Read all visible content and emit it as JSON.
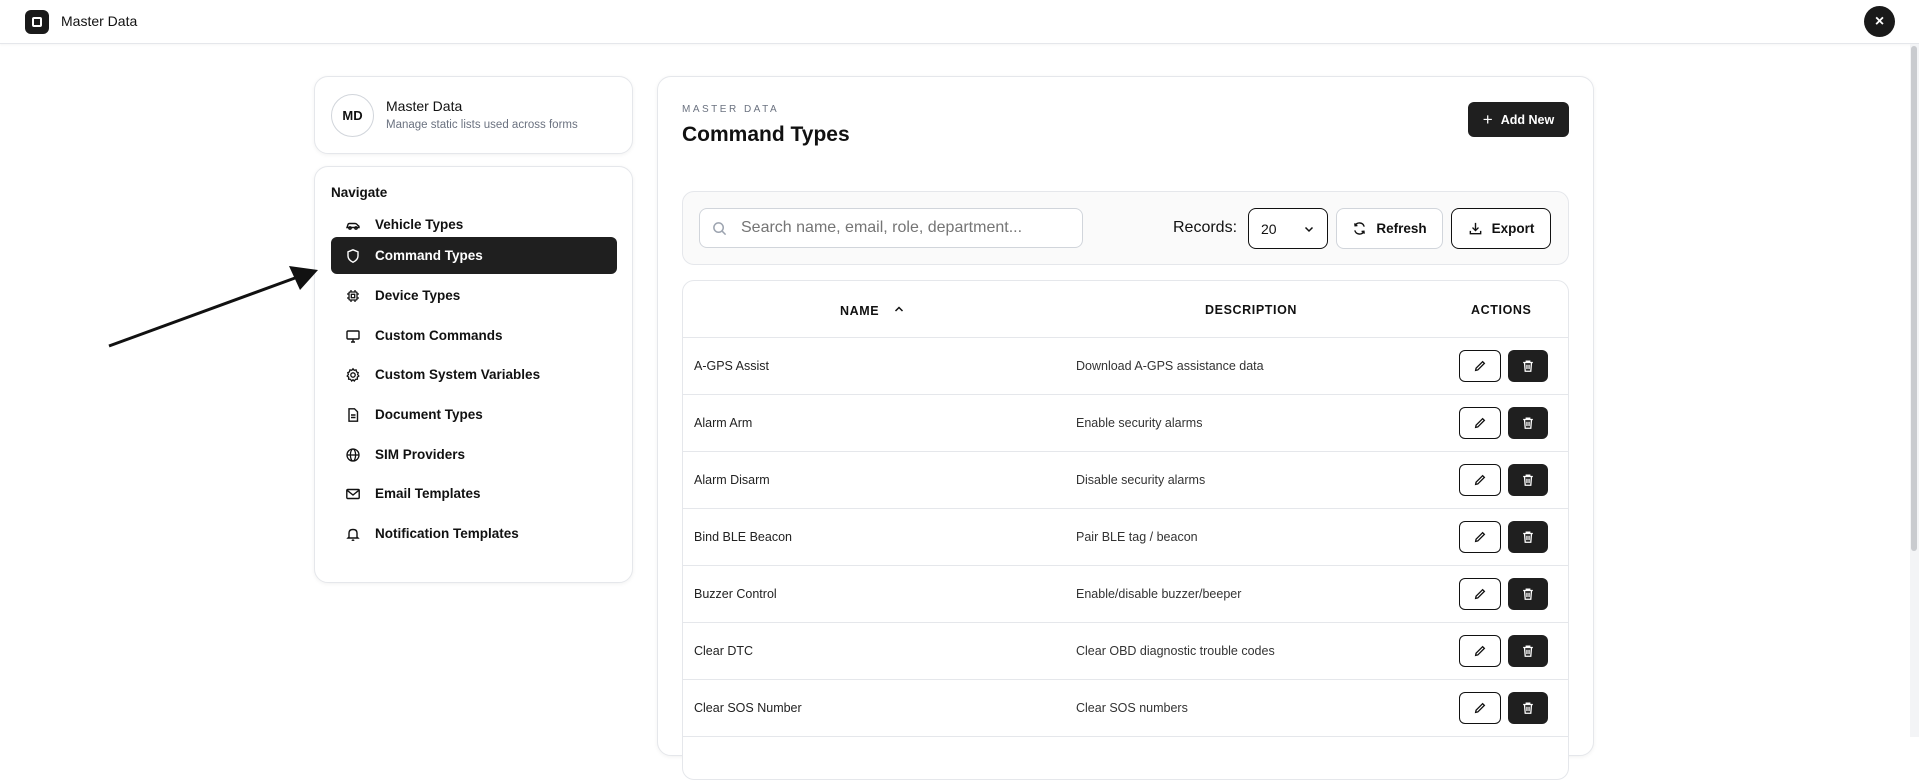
{
  "app": {
    "title": "Master Data",
    "close_label": "×"
  },
  "profile": {
    "initials": "MD",
    "title": "Master Data",
    "subtitle": "Manage static lists used across forms"
  },
  "nav": {
    "heading": "Navigate",
    "items": [
      {
        "label": "Vehicle Types",
        "icon": "car-icon",
        "active": false
      },
      {
        "label": "Command Types",
        "icon": "shield-icon",
        "active": true
      },
      {
        "label": "Device Types",
        "icon": "chip-icon",
        "active": false
      },
      {
        "label": "Custom Commands",
        "icon": "monitor-icon",
        "active": false
      },
      {
        "label": "Custom System Variables",
        "icon": "gear-icon",
        "active": false
      },
      {
        "label": "Document Types",
        "icon": "document-icon",
        "active": false
      },
      {
        "label": "SIM Providers",
        "icon": "globe-icon",
        "active": false
      },
      {
        "label": "Email Templates",
        "icon": "mail-icon",
        "active": false
      },
      {
        "label": "Notification Templates",
        "icon": "bell-icon",
        "active": false
      }
    ]
  },
  "main": {
    "overline": "MASTER DATA",
    "title": "Command Types",
    "add_label": "Add New",
    "search_placeholder": "Search name, email, role, department...",
    "records_label": "Records:",
    "records_value": "20",
    "refresh_label": "Refresh",
    "export_label": "Export"
  },
  "table": {
    "columns": {
      "name": "NAME",
      "description": "DESCRIPTION",
      "actions": "ACTIONS"
    },
    "sort": {
      "column": "name",
      "direction": "ascending"
    },
    "rows": [
      {
        "name": "A-GPS Assist",
        "description": "Download A-GPS assistance data"
      },
      {
        "name": "Alarm Arm",
        "description": "Enable security alarms"
      },
      {
        "name": "Alarm Disarm",
        "description": "Disable security alarms"
      },
      {
        "name": "Bind BLE Beacon",
        "description": "Pair BLE tag / beacon"
      },
      {
        "name": "Buzzer Control",
        "description": "Enable/disable buzzer/beeper"
      },
      {
        "name": "Clear DTC",
        "description": "Clear OBD diagnostic trouble codes"
      },
      {
        "name": "Clear SOS Number",
        "description": "Clear SOS numbers"
      }
    ]
  },
  "colors": {
    "accent": "#1f1f1f",
    "border": "#e5e7eb",
    "muted": "#6b7280"
  }
}
